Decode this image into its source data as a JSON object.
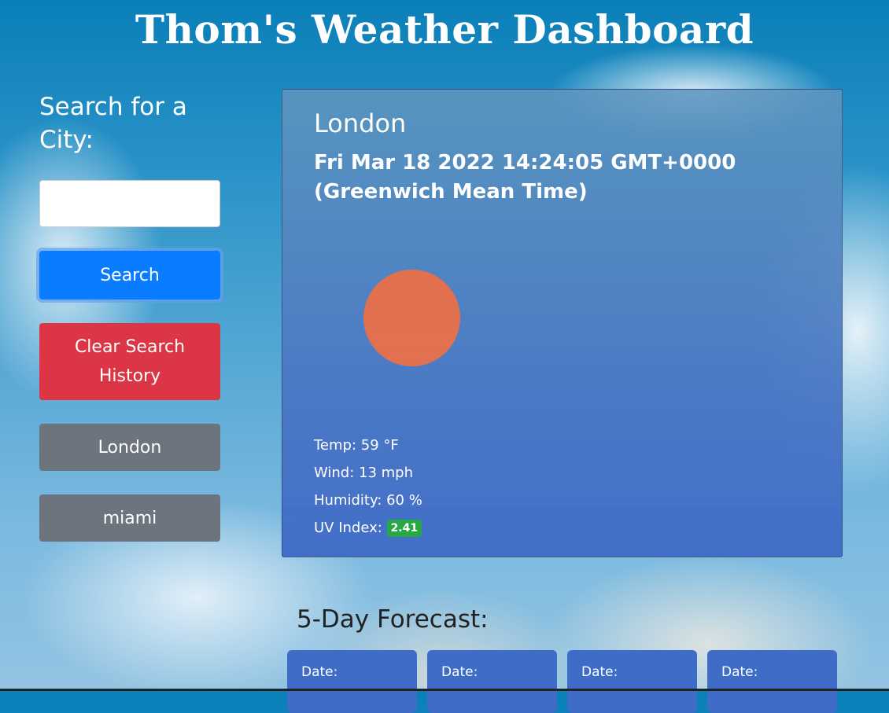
{
  "page": {
    "title": "Thom's Weather Dashboard"
  },
  "sidebar": {
    "heading": "Search for a City:",
    "search_input_value": "",
    "search_button_label": "Search",
    "clear_button_label": "Clear Search History",
    "history": [
      "London",
      "miami"
    ]
  },
  "current": {
    "city": "London",
    "datetime": "Fri Mar 18 2022 14:24:05 GMT+0000 (Greenwich Mean Time)",
    "icon": "sun-icon",
    "temp": "Temp: 59 °F",
    "wind": "Wind: 13 mph",
    "humidity": "Humidity: 60 %",
    "uv_label": "UV Index:",
    "uv_value": "2.41"
  },
  "forecast": {
    "heading": "5-Day Forecast:",
    "cards": [
      {
        "date_label": "Date:"
      },
      {
        "date_label": "Date:"
      },
      {
        "date_label": "Date:"
      },
      {
        "date_label": "Date:"
      }
    ]
  },
  "colors": {
    "primary": "#0a7cff",
    "danger": "#dc3545",
    "secondary": "#6c757d",
    "uv_badge": "#28a745",
    "forecast_card": "#3e6cc6",
    "sun": "#ee7044"
  }
}
